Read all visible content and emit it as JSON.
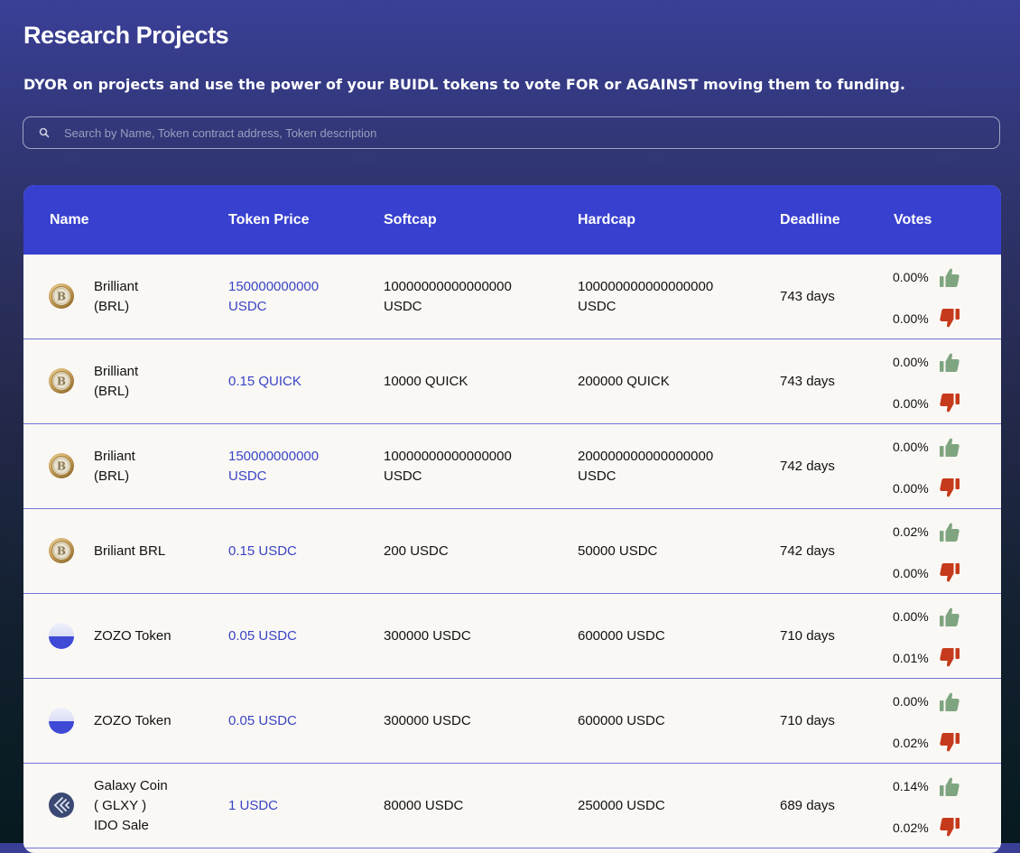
{
  "header": {
    "title": "Research Projects",
    "subtitle": "DYOR on projects and use the power of your BUIDL tokens to vote FOR or AGAINST moving them to funding."
  },
  "search": {
    "placeholder": "Search by Name, Token contract address, Token description",
    "value": ""
  },
  "table": {
    "columns": [
      "Name",
      "Token Price",
      "Softcap",
      "Hardcap",
      "Deadline",
      "Votes"
    ],
    "rows": [
      {
        "logo": "bitcoin-coin-icon",
        "name_lines": [
          "Brilliant",
          "(BRL)"
        ],
        "price_lines": [
          "150000000000",
          "USDC"
        ],
        "softcap_lines": [
          "10000000000000000",
          "USDC"
        ],
        "hardcap_lines": [
          "100000000000000000",
          "USDC"
        ],
        "deadline": "743 days",
        "votes_for": "0.00%",
        "votes_against": "0.00%"
      },
      {
        "logo": "bitcoin-coin-icon",
        "name_lines": [
          "Brilliant",
          "(BRL)"
        ],
        "price_lines": [
          "0.15 QUICK"
        ],
        "softcap_lines": [
          "10000 QUICK"
        ],
        "hardcap_lines": [
          "200000 QUICK"
        ],
        "deadline": "743 days",
        "votes_for": "0.00%",
        "votes_against": "0.00%"
      },
      {
        "logo": "bitcoin-coin-icon",
        "name_lines": [
          "Briliant",
          "(BRL)"
        ],
        "price_lines": [
          "150000000000",
          "USDC"
        ],
        "softcap_lines": [
          "10000000000000000",
          "USDC"
        ],
        "hardcap_lines": [
          "200000000000000000",
          "USDC"
        ],
        "deadline": "742 days",
        "votes_for": "0.00%",
        "votes_against": "0.00%"
      },
      {
        "logo": "bitcoin-coin-icon",
        "name_lines": [
          "Briliant BRL"
        ],
        "price_lines": [
          "0.15 USDC"
        ],
        "softcap_lines": [
          "200 USDC"
        ],
        "hardcap_lines": [
          "50000 USDC"
        ],
        "deadline": "742 days",
        "votes_for": "0.02%",
        "votes_against": "0.00%"
      },
      {
        "logo": "half-circle-icon",
        "name_lines": [
          "ZOZO Token"
        ],
        "price_lines": [
          "0.05 USDC"
        ],
        "softcap_lines": [
          "300000 USDC"
        ],
        "hardcap_lines": [
          "600000 USDC"
        ],
        "deadline": "710 days",
        "votes_for": "0.00%",
        "votes_against": "0.01%"
      },
      {
        "logo": "half-circle-icon",
        "name_lines": [
          "ZOZO Token"
        ],
        "price_lines": [
          "0.05 USDC"
        ],
        "softcap_lines": [
          "300000 USDC"
        ],
        "hardcap_lines": [
          "600000 USDC"
        ],
        "deadline": "710 days",
        "votes_for": "0.00%",
        "votes_against": "0.02%"
      },
      {
        "logo": "galaxy-coin-icon",
        "name_lines": [
          "Galaxy Coin",
          "( GLXY )",
          "IDO Sale"
        ],
        "price_lines": [
          "1 USDC"
        ],
        "softcap_lines": [
          "80000 USDC"
        ],
        "hardcap_lines": [
          "250000 USDC"
        ],
        "deadline": "689 days",
        "votes_for": "0.14%",
        "votes_against": "0.02%"
      }
    ]
  },
  "colors": {
    "header_bg": "#3840cf",
    "price_text": "#3a44c4",
    "thumb_up": "#7fa580",
    "thumb_down": "#c53a1b",
    "row_bg": "#faf8f5"
  }
}
